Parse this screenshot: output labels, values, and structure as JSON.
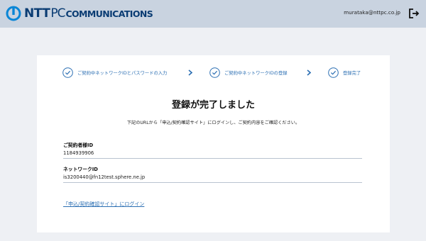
{
  "header": {
    "logo": {
      "ntt": "NTT",
      "pc": "PC",
      "communications": "COMMUNICATIONS"
    },
    "user_email": "murataka@nttpc.co.jp",
    "logout_icon": "logout-icon"
  },
  "steps": [
    {
      "label": "ご契約中ネットワークIDとパスワードの入力",
      "icon": "check-circle-icon"
    },
    {
      "label": "ご契約中ネットワークIDの登録",
      "icon": "check-circle-icon"
    },
    {
      "label": "登録完了",
      "icon": "check-circle-icon"
    }
  ],
  "title": "登録が完了しました",
  "description": "下記のURLから「申込/契約確認サイト」にログインし、ご契約内容をご確認ください。",
  "fields": [
    {
      "label": "ご契約者様ID",
      "value": "1184939906"
    },
    {
      "label": "ネットワークID",
      "value": "is3200440@fn12test.sphere.ne.jp"
    }
  ],
  "login_link": "「申込/契約確認サイト」にログイン",
  "colors": {
    "header_bg": "#c9d3e0",
    "accent": "#2c6fb3",
    "logo": "#0a3c73"
  }
}
